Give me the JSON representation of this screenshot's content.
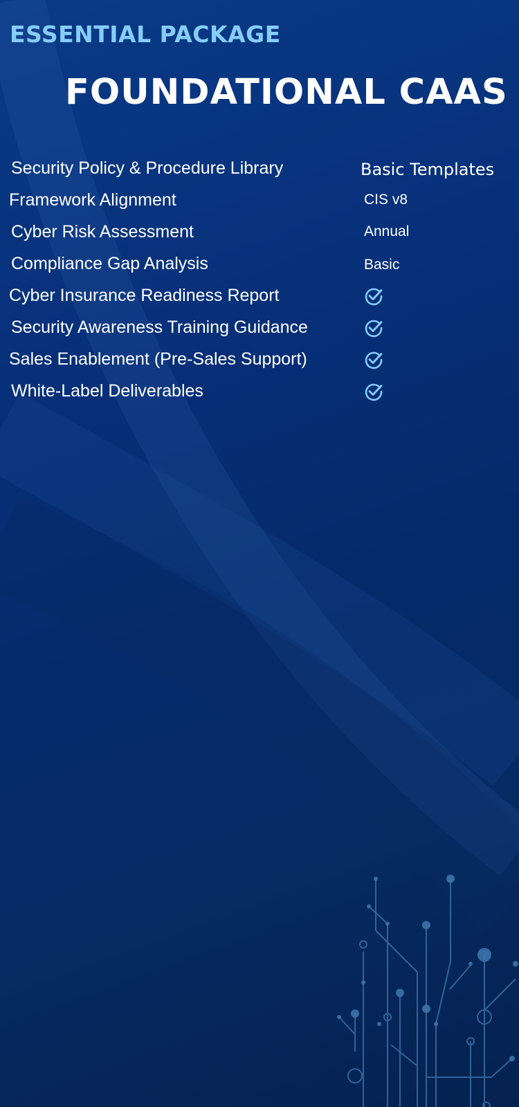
{
  "header": {
    "eyebrow": "ESSENTIAL PACKAGE",
    "title": "FOUNDATIONAL CAAS"
  },
  "features": [
    {
      "label": "Security Policy & Procedure Library",
      "value": "Basic Templates"
    },
    {
      "label": "Framework Alignment",
      "value": "CIS v8"
    },
    {
      "label": "Cyber Risk Assessment",
      "value": "Annual"
    },
    {
      "label": "Compliance Gap Analysis",
      "value": "Basic"
    },
    {
      "label": "Cyber Insurance Readiness Report",
      "icon": "check-circle-icon"
    },
    {
      "label": "Security Awareness Training Guidance",
      "icon": "check-circle-icon"
    },
    {
      "label": "Sales Enablement (Pre-Sales Support)",
      "icon": "check-circle-icon"
    },
    {
      "label": "White-Label Deliverables",
      "icon": "check-circle-icon"
    }
  ],
  "colors": {
    "background": "#062a63",
    "accent": "#86cdfb",
    "text": "#ffffff",
    "circuit": "#3f78b0"
  }
}
